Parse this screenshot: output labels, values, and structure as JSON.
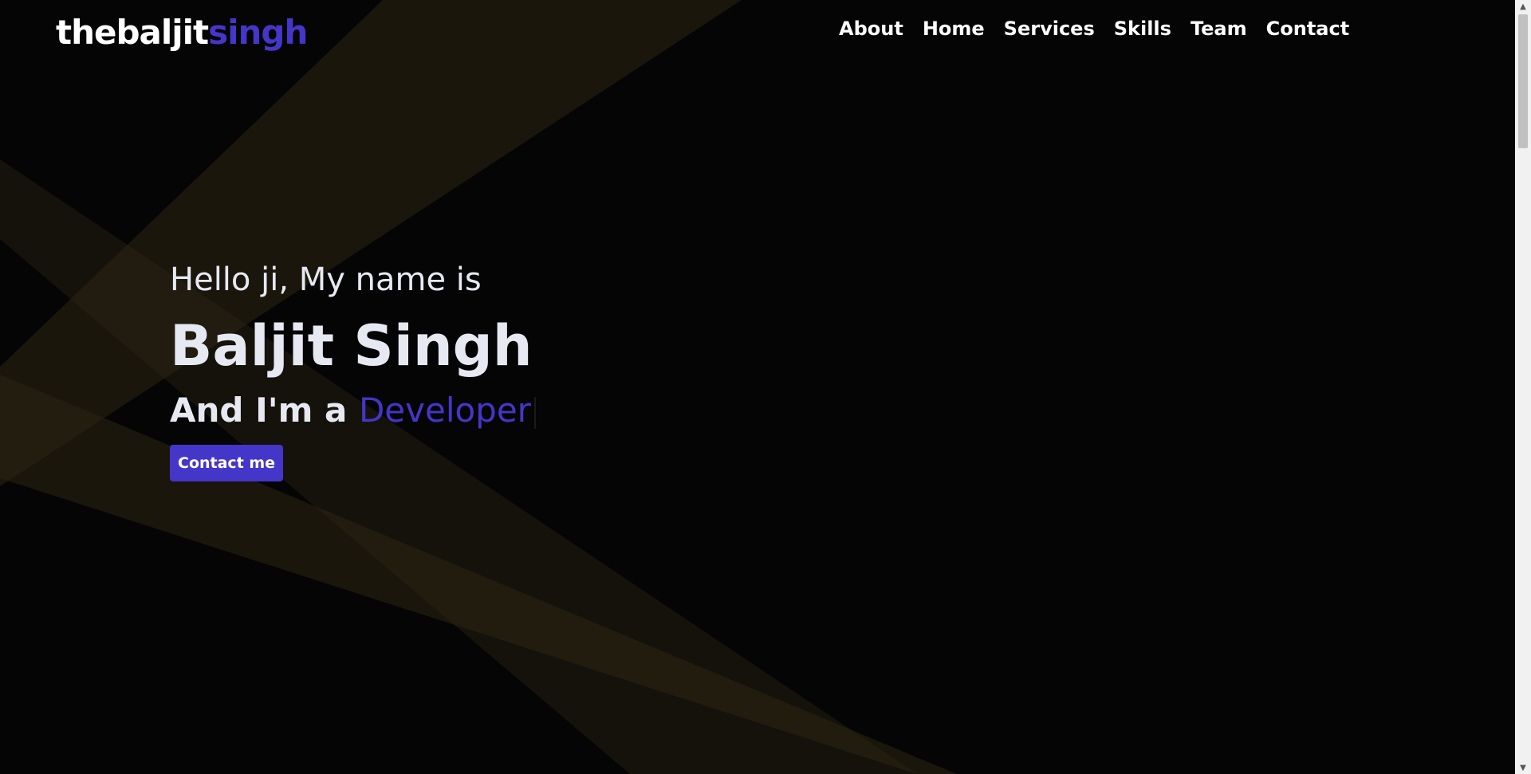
{
  "navbar": {
    "logo_main": "thebaljit",
    "logo_accent": "singh",
    "links": [
      "About",
      "Home",
      "Services",
      "Skills",
      "Team",
      "Contact"
    ]
  },
  "hero": {
    "greeting": "Hello ji, My name is",
    "name": "Baljit Singh",
    "role_prefix": "And I'm a",
    "role_word": "Developer",
    "cta_label": "Contact me"
  },
  "colors": {
    "background": "#050505",
    "accent": "#4436c9",
    "text": "#e6e9f2",
    "beam": "#2b2413"
  },
  "icons": {
    "scroll_up": "triangle-up-icon",
    "scroll_down": "triangle-down-icon"
  }
}
